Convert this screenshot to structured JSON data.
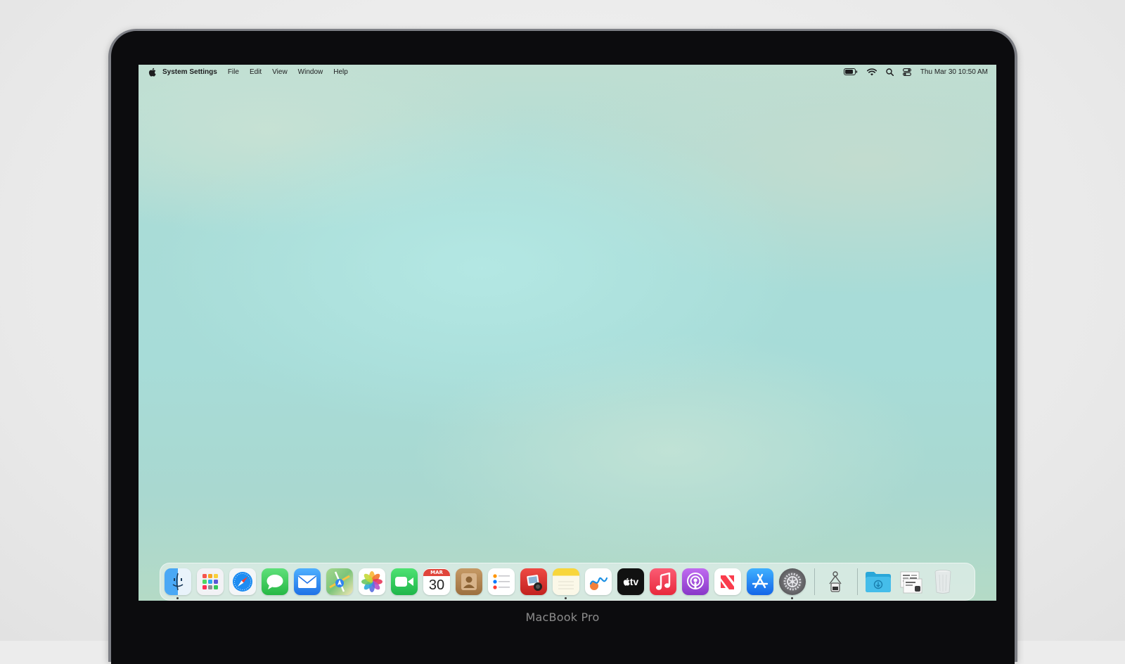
{
  "menubar": {
    "apple_icon": "apple-logo-icon",
    "app_name": "System Settings",
    "menus": [
      "File",
      "Edit",
      "View",
      "Window",
      "Help"
    ],
    "status_icons": [
      "battery-icon",
      "wifi-icon",
      "spotlight-search-icon",
      "control-center-icon"
    ],
    "clock": "Thu Mar 30  10:50 AM"
  },
  "dock": {
    "apps": [
      {
        "name": "Finder",
        "icon": "finder-icon",
        "running": true,
        "color": "#2f8fef"
      },
      {
        "name": "Launchpad",
        "icon": "launchpad-icon",
        "running": false,
        "color": "#f2f2f5"
      },
      {
        "name": "Safari",
        "icon": "safari-icon",
        "running": false,
        "color": "#1d8cf2"
      },
      {
        "name": "Messages",
        "icon": "messages-icon",
        "running": false,
        "color": "#34c759"
      },
      {
        "name": "Mail",
        "icon": "mail-icon",
        "running": false,
        "color": "#2d8ef0"
      },
      {
        "name": "Maps",
        "icon": "maps-icon",
        "running": false,
        "color": "#7cc47a"
      },
      {
        "name": "Photos",
        "icon": "photos-icon",
        "running": false,
        "color": "#ffffff"
      },
      {
        "name": "FaceTime",
        "icon": "facetime-icon",
        "running": false,
        "color": "#30c85a"
      },
      {
        "name": "Calendar",
        "icon": "calendar-icon",
        "running": false,
        "color": "#ffffff",
        "month": "MAR",
        "day": "30"
      },
      {
        "name": "Contacts",
        "icon": "contacts-icon",
        "running": false,
        "color": "#b08552"
      },
      {
        "name": "Reminders",
        "icon": "reminders-icon",
        "running": false,
        "color": "#ffffff"
      },
      {
        "name": "Photo Booth",
        "icon": "photo-booth-icon",
        "running": false,
        "color": "#d9322f"
      },
      {
        "name": "Notes",
        "icon": "notes-icon",
        "running": true,
        "color": "#f6f1c8"
      },
      {
        "name": "Freeform",
        "icon": "freeform-icon",
        "running": false,
        "color": "#ffffff"
      },
      {
        "name": "TV",
        "icon": "apple-tv-icon",
        "running": false,
        "color": "#111111",
        "label": "tv"
      },
      {
        "name": "Music",
        "icon": "music-icon",
        "running": false,
        "color": "#f03a4c"
      },
      {
        "name": "Podcasts",
        "icon": "podcasts-icon",
        "running": false,
        "color": "#9b48d6"
      },
      {
        "name": "News",
        "icon": "news-icon",
        "running": false,
        "color": "#ffffff"
      },
      {
        "name": "App Store",
        "icon": "app-store-icon",
        "running": false,
        "color": "#1f7ff0"
      },
      {
        "name": "System Settings",
        "icon": "system-settings-icon",
        "running": true,
        "color": "#6e6e73"
      }
    ],
    "extras": [
      {
        "name": "Automator",
        "icon": "automator-icon",
        "running": false,
        "color": "#e6e6e6"
      }
    ],
    "stacks": [
      {
        "name": "Downloads",
        "icon": "downloads-folder-icon",
        "color": "#2aa7d9"
      },
      {
        "name": "Documents Stack",
        "icon": "documents-stack-icon",
        "color": "#e8e8e8"
      },
      {
        "name": "Trash",
        "icon": "trash-icon",
        "color": "#e2e6e6"
      }
    ]
  },
  "device_label": "MacBook Pro"
}
